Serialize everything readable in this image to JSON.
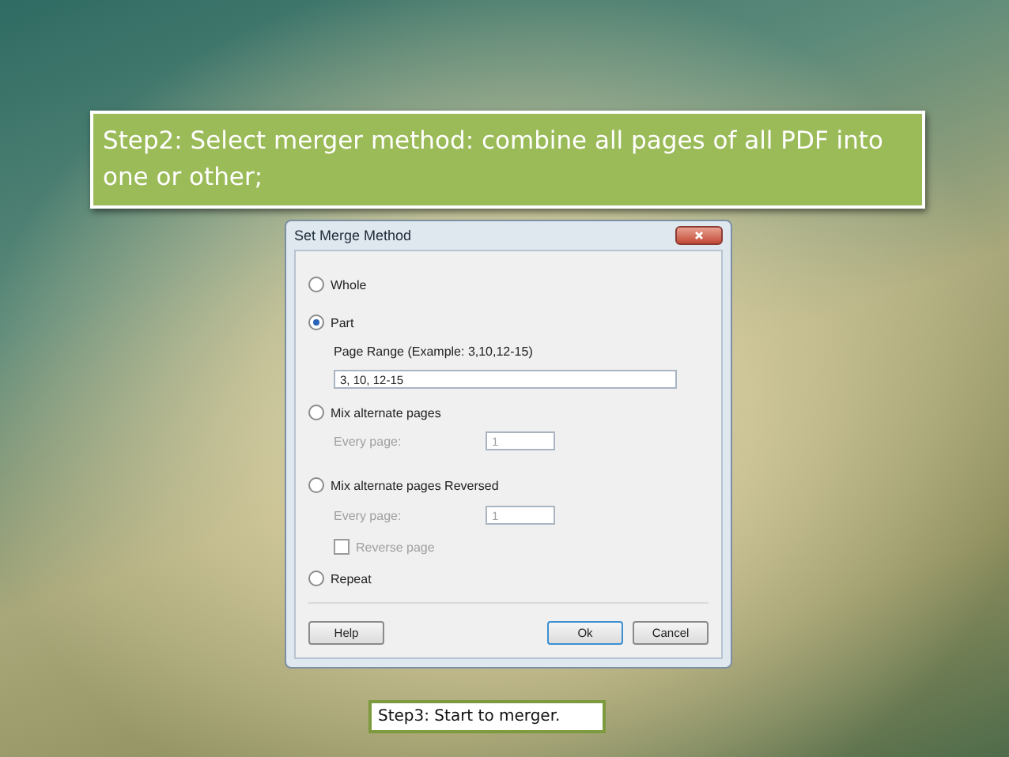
{
  "heading": "Step2: Select merger method: combine all pages of all PDF into one or other;",
  "dialog": {
    "title": "Set Merge Method",
    "items": [
      {
        "kind": "radio",
        "label": "Whole",
        "selected": false
      },
      {
        "kind": "radio",
        "label": "Part",
        "selected": true
      },
      {
        "kind": "label",
        "label": "Page Range (Example: 3,10,12-15)"
      },
      {
        "kind": "field",
        "value": "3, 10, 12-15",
        "disabled": false
      },
      {
        "kind": "radio",
        "label": "Mix alternate pages",
        "selected": false
      },
      {
        "kind": "labeled_field",
        "label": "Every page:",
        "value": "1",
        "disabled": true
      },
      {
        "kind": "radio",
        "label": "Mix alternate pages Reversed",
        "selected": false
      },
      {
        "kind": "labeled_field",
        "label": "Every page:",
        "value": "1",
        "disabled": true
      },
      {
        "kind": "checkbox",
        "label": "Reverse page",
        "checked": false,
        "disabled": true
      },
      {
        "kind": "radio",
        "label": "Repeat",
        "selected": false
      }
    ],
    "buttons": [
      {
        "label": "Help",
        "default": false
      },
      {
        "label": "Ok",
        "default": true
      },
      {
        "label": "Cancel",
        "default": false
      }
    ]
  },
  "caption": "Step3: Start to merger."
}
